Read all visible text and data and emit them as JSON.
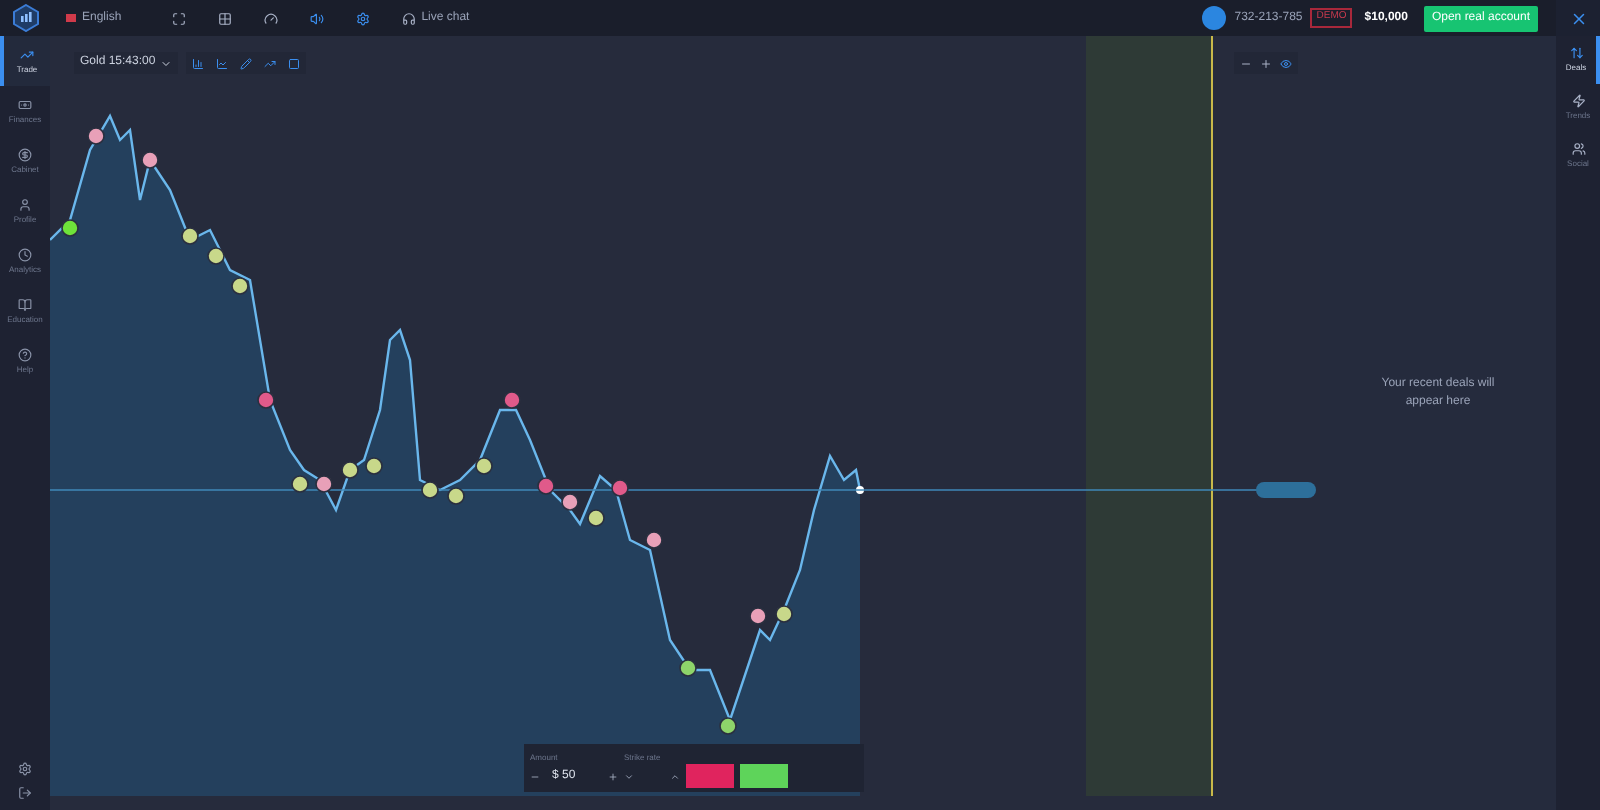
{
  "topbar": {
    "language": "English",
    "live_chat": "Live chat",
    "account_id": "732-213-785",
    "account_type": "DEMO",
    "balance": "$10,000",
    "open_account": "Open real account"
  },
  "sidebar": {
    "items": [
      {
        "label": "Trade",
        "selected": true
      },
      {
        "label": "Finances",
        "selected": false
      },
      {
        "label": "Cabinet",
        "selected": false
      },
      {
        "label": "Profile",
        "selected": false
      },
      {
        "label": "Analytics",
        "selected": false
      },
      {
        "label": "Education",
        "selected": false
      },
      {
        "label": "Help",
        "selected": false
      }
    ]
  },
  "chart": {
    "asset": "Gold 15:43:00"
  },
  "trade_panel": {
    "amount_label": "Amount",
    "amount": "$ 50",
    "strike_label": "Strike rate"
  },
  "deals_panel": {
    "empty_text": "Your recent deals will appear here"
  },
  "right_sidebar": {
    "items": [
      {
        "label": "Deals",
        "selected": true
      },
      {
        "label": "Trends",
        "selected": false
      },
      {
        "label": "Social",
        "selected": false
      }
    ]
  }
}
